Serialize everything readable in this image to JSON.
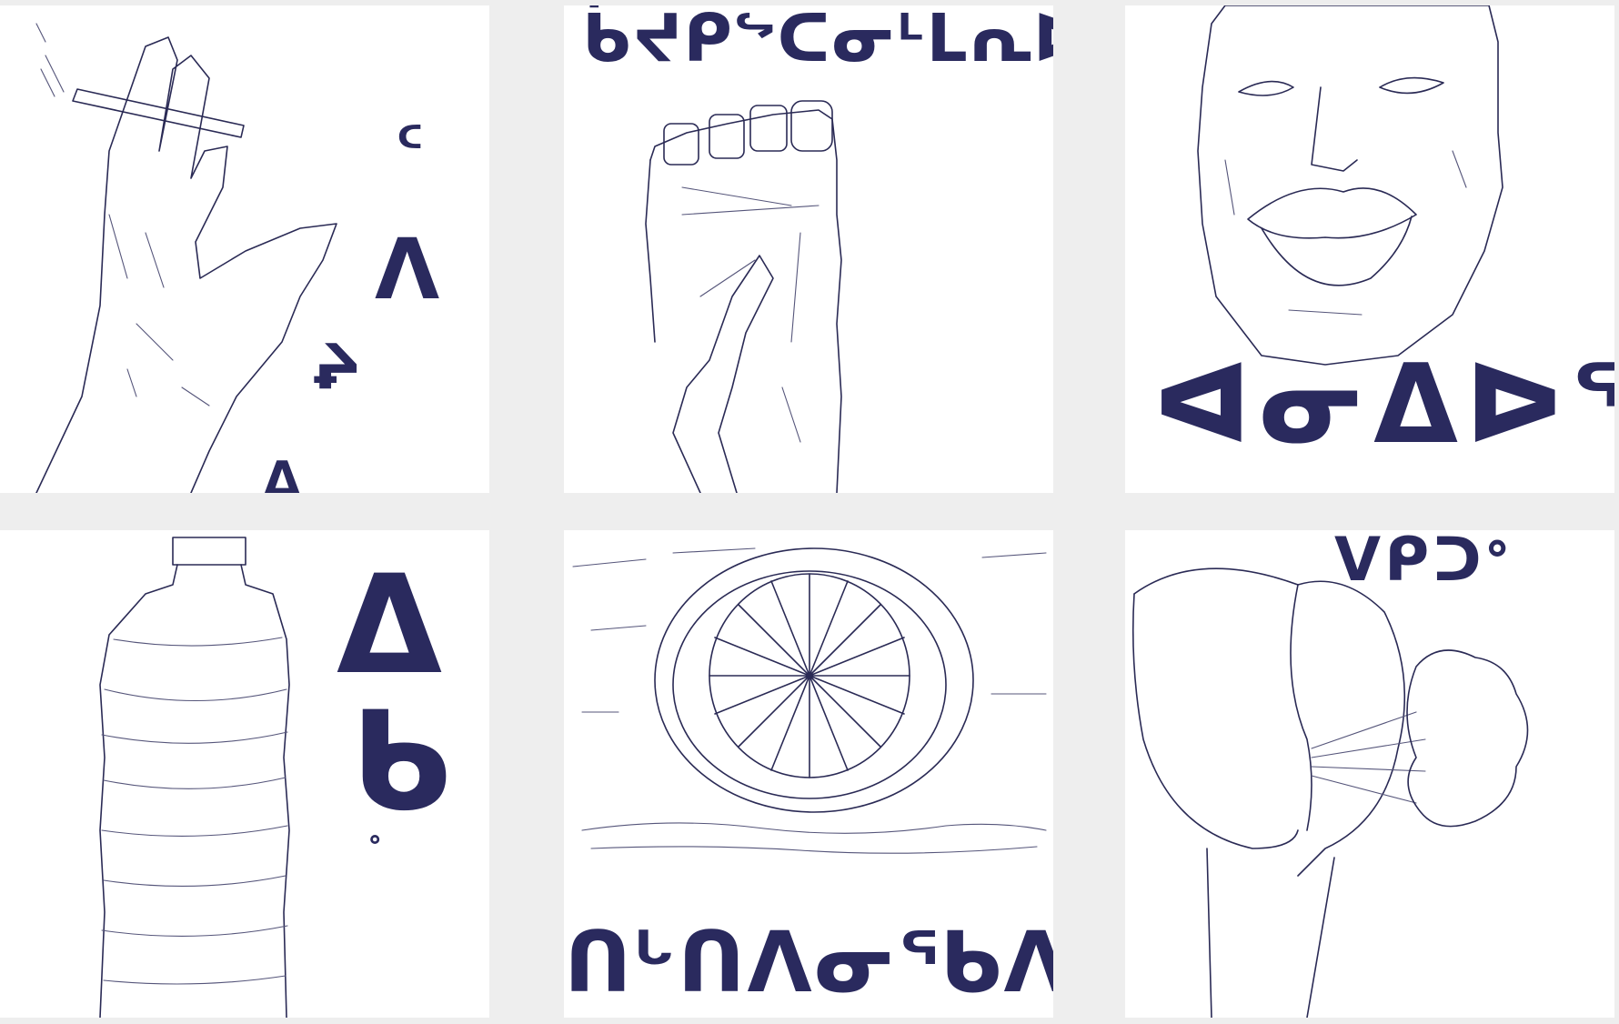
{
  "grid": {
    "tiles": [
      {
        "subject": "hand-with-cigarette",
        "syllabics": [
          "ᑦ",
          "ᐱ",
          "ᖨ",
          "ᐃ"
        ]
      },
      {
        "subject": "foot-with-feather",
        "syllabics": "ᑳᔪᑭᖦᑕᓂᒻᒪᕆᐅᕐᓂᖅ"
      },
      {
        "subject": "face-lips",
        "syllabics": "ᐊᓂᐃᐅᖅ"
      },
      {
        "subject": "water-bottle",
        "syllabics": [
          "ᐃ",
          "ᑲ",
          "ᐤ"
        ]
      },
      {
        "subject": "wheel",
        "syllabics": "ᑎᒡᑎᐱᓂᖃᐱᖅ"
      },
      {
        "subject": "buttocks-with-smoke",
        "syllabics": "ᐯᑭᑐᐤ"
      }
    ]
  },
  "colors": {
    "ink": "#2a2a5e",
    "paper": "#ffffff",
    "gutter": "#eeeeee"
  }
}
